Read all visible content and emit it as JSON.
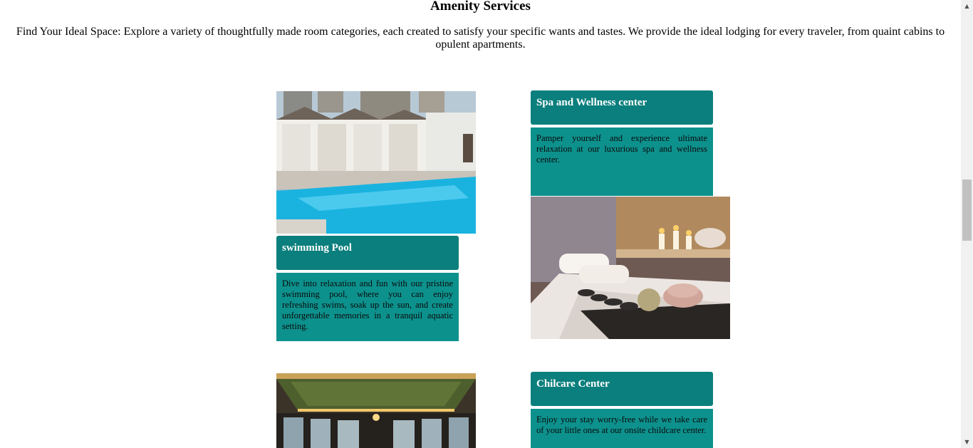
{
  "section": {
    "title": "Amenity Services",
    "intro": "Find Your Ideal Space: Explore a variety of thoughtfully made room categories, each created to satisfy your specific wants and tastes. We provide the ideal lodging for every traveler, from quaint cabins to opulent apartments."
  },
  "amenities": [
    {
      "title": "swimming Pool",
      "description": "Dive into relaxation and fun with our pristine swimming pool, where you can enjoy refreshing swims, soak up the sun, and create unforgettable memories in a tranquil aquatic setting."
    },
    {
      "title": "Spa and Wellness center",
      "description": "Pamper yourself and experience ultimate relaxation at our luxurious spa and wellness center."
    },
    {
      "title": "Chilcare Center",
      "description": "Enjoy your stay worry-free while we take care of your little ones at our onsite childcare center."
    }
  ],
  "images": {
    "pool": "swimming-pool-photo",
    "spa": "spa-photo",
    "lounge": "lounge-photo"
  },
  "colors": {
    "card_header": "#0b7f7d",
    "card_body": "#0d918d"
  }
}
